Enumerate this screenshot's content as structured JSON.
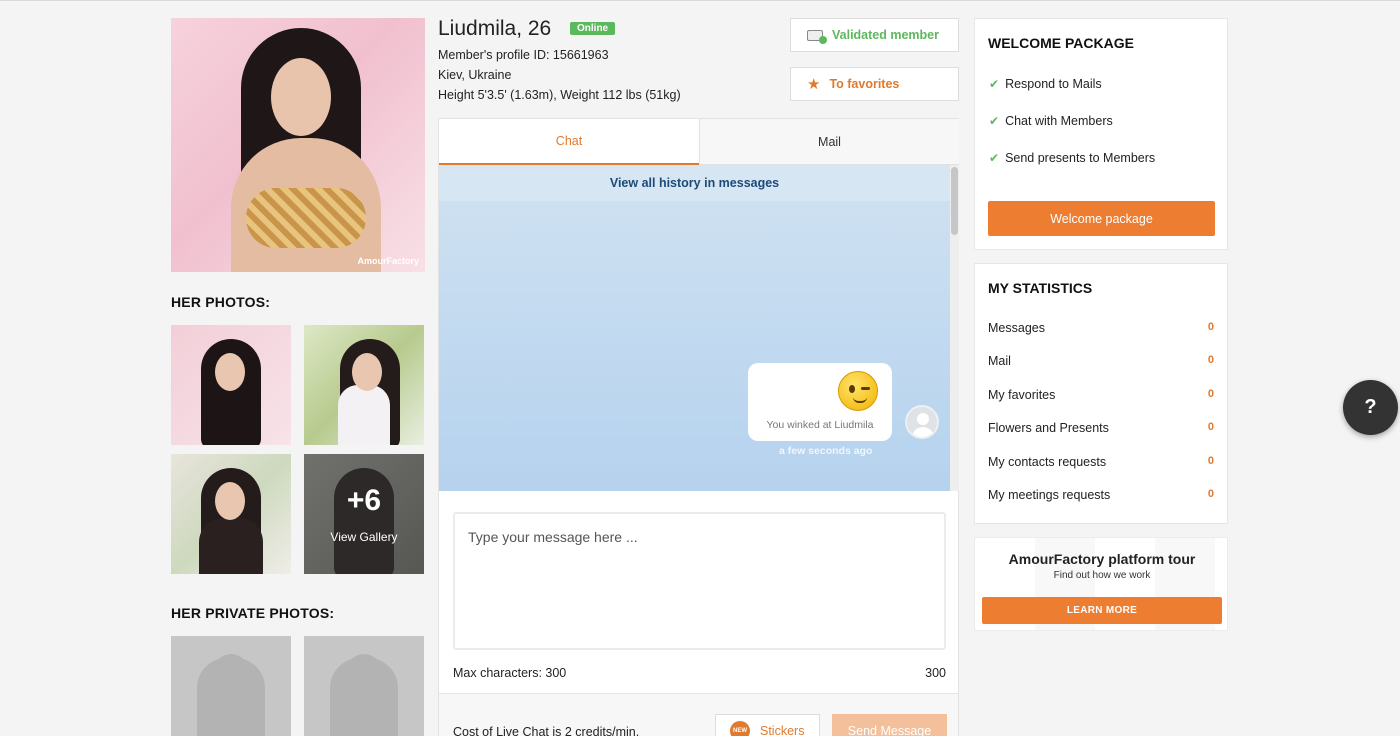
{
  "profile": {
    "name_age": "Liudmila, 26",
    "status_badge": "Online",
    "profile_id": "Member's profile ID: 15661963",
    "location": "Kiev, Ukraine",
    "height_weight": "Height 5'3.5' (1.63m), Weight 112 lbs (51kg)",
    "watermark": "AmourFactory"
  },
  "actions": {
    "validated": "Validated member",
    "favorites": "To favorites"
  },
  "photos": {
    "title": "HER PHOTOS:",
    "more_count": "+6",
    "view_gallery": "View Gallery",
    "private_title": "HER PRIVATE PHOTOS:"
  },
  "chat": {
    "tabs": [
      "Chat",
      "Mail"
    ],
    "history_link": "View all history in messages",
    "bubble_text": "You winked at Liudmila",
    "timestamp": "a few seconds ago",
    "input_placeholder": "Type your message here ...",
    "max_chars_label": "Max characters: 300",
    "max_chars_count": "300",
    "cost_text": "Cost of Live Chat is 2 credits/min.",
    "stickers_label": "Stickers",
    "new_badge": "NEW",
    "send_label": "Send Message"
  },
  "welcome": {
    "title": "WELCOME PACKAGE",
    "items": [
      "Respond to Mails",
      "Chat with Members",
      "Send presents to Members"
    ],
    "button": "Welcome package"
  },
  "stats": {
    "title": "MY STATISTICS",
    "rows": [
      {
        "label": "Messages",
        "value": "0"
      },
      {
        "label": "Mail",
        "value": "0"
      },
      {
        "label": "My favorites",
        "value": "0"
      },
      {
        "label": "Flowers and Presents",
        "value": "0"
      },
      {
        "label": "My contacts requests",
        "value": "0"
      },
      {
        "label": "My meetings requests",
        "value": "0"
      }
    ]
  },
  "tour": {
    "title": "AmourFactory platform tour",
    "subtitle": "Find out how we work",
    "button": "LEARN MORE"
  },
  "help": {
    "label": "?"
  },
  "colors": {
    "accent": "#ed7d31",
    "online": "#5cb85c",
    "history_bar": "#d6e6f3"
  }
}
